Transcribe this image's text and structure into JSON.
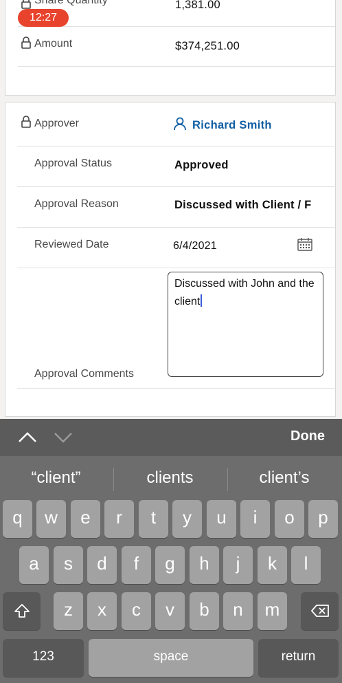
{
  "status": {
    "time": "12:27"
  },
  "details": {
    "share_quantity_label": "Share Quantity",
    "share_quantity_value": "1,381.00",
    "amount_label": "Amount",
    "amount_value": "$374,251.00"
  },
  "approval": {
    "approver_label": "Approver",
    "approver_value": "Richard Smith",
    "status_label": "Approval Status",
    "status_value": "Approved",
    "reason_label": "Approval Reason",
    "reason_value": "Discussed with Client / F",
    "reviewed_date_label": "Reviewed Date",
    "reviewed_date_value": "6/4/2021",
    "comments_label": "Approval Comments",
    "comments_value": "Discussed with John and the client"
  },
  "keyboard": {
    "done_label": "Done",
    "suggestions": [
      "“client”",
      "clients",
      "client’s"
    ],
    "row1": [
      "q",
      "w",
      "e",
      "r",
      "t",
      "y",
      "u",
      "i",
      "o",
      "p"
    ],
    "row2": [
      "a",
      "s",
      "d",
      "f",
      "g",
      "h",
      "j",
      "k",
      "l"
    ],
    "row3": [
      "z",
      "x",
      "c",
      "v",
      "b",
      "n",
      "m"
    ],
    "numbers_label": "123",
    "space_label": "space",
    "return_label": "return"
  },
  "icons": {
    "lock": "lock-icon",
    "person": "person-icon",
    "calendar": "calendar-icon",
    "shift": "shift-icon",
    "backspace": "backspace-icon",
    "chevron_up": "chevron-up-icon",
    "chevron_down": "chevron-down-icon"
  },
  "colors": {
    "accent": "#115ea3",
    "badge": "#e8432d",
    "caret": "#3b5bdb"
  }
}
